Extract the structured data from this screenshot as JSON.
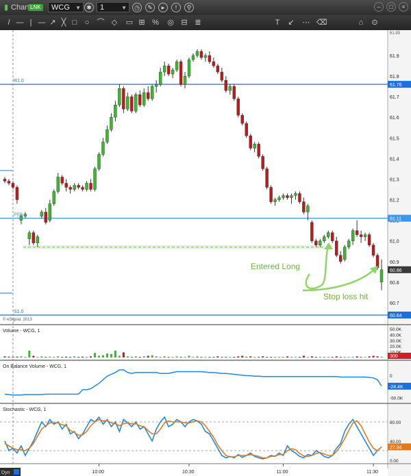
{
  "window": {
    "title": "Chart",
    "badge": "LNK",
    "symbol": "WCG",
    "interval": "1",
    "symbol_menu_icon": "chevron-down-icon",
    "interval_menu_icon": "chevron-down-icon",
    "toolbar_icons": [
      "gear-icon",
      "clock-icon",
      "edit-icon",
      "play-icon",
      "alert-icon",
      "link-icon"
    ],
    "window_buttons": [
      "minimize-icon",
      "maximize-icon",
      "close-icon"
    ]
  },
  "drawing_toolbar": {
    "tools": [
      "/",
      "—",
      "|",
      "—",
      "↗",
      "╳",
      "□",
      "○",
      "⌒",
      "◇",
      "▭",
      "⊞",
      "%",
      "◎",
      "⊟",
      "≣",
      "T",
      "↙",
      "⋯",
      "⌫",
      "⌂",
      "⊙"
    ]
  },
  "price_panel": {
    "copyright": "© eSignal, 2013",
    "levels": [
      {
        "label": "R1.0",
        "value": 61.76,
        "color": "#1e6fd9"
      },
      {
        "label": "P(0)",
        "value": 61.11,
        "color": "#3f95e6"
      },
      {
        "label": "S1.0",
        "value": 60.64,
        "color": "#1e6fd9"
      }
    ],
    "entry_line": {
      "value": 60.97,
      "color": "#8fd66a"
    },
    "axis_ticks": [
      "61.9",
      "61.8",
      "61.7",
      "61.6",
      "61.5",
      "61.4",
      "61.3",
      "61.2",
      "61.1",
      "61.0",
      "60.9",
      "60.8",
      "60.7"
    ],
    "axis_top": "61.93",
    "price_tags": [
      {
        "text": "61.76",
        "value": 61.76,
        "bg": "#1e6fd9"
      },
      {
        "text": "61.11",
        "value": 61.11,
        "bg": "#3f95e6"
      },
      {
        "text": "60.86",
        "value": 60.86,
        "bg": "#3a3a3a"
      },
      {
        "text": "60.64",
        "value": 60.64,
        "bg": "#1e6fd9"
      }
    ],
    "annotations": [
      {
        "text": "Entered Long",
        "color": "#6ab53a"
      },
      {
        "text": "Stop loss hit",
        "color": "#6ab53a"
      }
    ]
  },
  "volume_panel": {
    "title": "Volume - WCG, 1",
    "axis_ticks": [
      "50.0K",
      "40.0K",
      "30.0K",
      "20.0K",
      "10.0K"
    ],
    "last_tag": "300",
    "last_tag_bg": "#cc2222"
  },
  "obv_panel": {
    "title": "On Balance Volume - WCG, 1",
    "axis_ticks": [
      "0",
      "-50.0K"
    ],
    "last_tag": "-24.4K",
    "last_tag_bg": "#1e6fd9",
    "line_color": "#1e88e5"
  },
  "stoch_panel": {
    "title": "Stochastic - WCG, 1",
    "axis_ticks": [
      "80.00",
      "40.00",
      "0.00"
    ],
    "last_tag": "27.94",
    "last_tag_bg": "#e07a1f",
    "k_color": "#1e88e5",
    "d_color": "#e07a1f"
  },
  "time_axis": {
    "labels": [
      "10:00",
      "10:30",
      "11:00",
      "11:30"
    ],
    "left_label": "Dyn",
    "left_icon": "fit-icon"
  },
  "chart_data": {
    "type": "candlestick",
    "symbol": "WCG",
    "interval": "1",
    "price_ylim": [
      60.6,
      61.93
    ],
    "x_ticks": [
      "10:00",
      "10:30",
      "11:00",
      "11:30"
    ],
    "candles": [
      {
        "o": 61.3,
        "h": 61.31,
        "l": 61.28,
        "c": 61.29
      },
      {
        "o": 61.29,
        "h": 61.3,
        "l": 61.27,
        "c": 61.28
      },
      {
        "o": 61.28,
        "h": 61.29,
        "l": 61.25,
        "c": 61.26
      },
      {
        "o": 61.26,
        "h": 61.27,
        "l": 61.18,
        "c": 61.2
      },
      {
        "o": 61.1,
        "h": 61.13,
        "l": 61.08,
        "c": 61.12
      },
      {
        "o": 61.12,
        "h": 61.14,
        "l": 61.11,
        "c": 61.13
      },
      {
        "o": 61.01,
        "h": 61.05,
        "l": 60.98,
        "c": 61.04
      },
      {
        "o": 61.04,
        "h": 61.05,
        "l": 60.98,
        "c": 60.99
      },
      {
        "o": 60.99,
        "h": 61.03,
        "l": 60.97,
        "c": 61.02
      },
      {
        "o": 61.12,
        "h": 61.15,
        "l": 61.11,
        "c": 61.14
      },
      {
        "o": 61.14,
        "h": 61.16,
        "l": 61.08,
        "c": 61.09
      },
      {
        "o": 61.1,
        "h": 61.2,
        "l": 61.09,
        "c": 61.18
      },
      {
        "o": 61.18,
        "h": 61.25,
        "l": 61.17,
        "c": 61.24
      },
      {
        "o": 61.24,
        "h": 61.33,
        "l": 61.23,
        "c": 61.31
      },
      {
        "o": 61.31,
        "h": 61.32,
        "l": 61.27,
        "c": 61.28
      },
      {
        "o": 61.28,
        "h": 61.3,
        "l": 61.24,
        "c": 61.26
      },
      {
        "o": 61.26,
        "h": 61.27,
        "l": 61.23,
        "c": 61.25
      },
      {
        "o": 61.25,
        "h": 61.28,
        "l": 61.24,
        "c": 61.27
      },
      {
        "o": 61.27,
        "h": 61.28,
        "l": 61.25,
        "c": 61.26
      },
      {
        "o": 61.26,
        "h": 61.27,
        "l": 61.24,
        "c": 61.25
      },
      {
        "o": 61.25,
        "h": 61.29,
        "l": 61.24,
        "c": 61.28
      },
      {
        "o": 61.28,
        "h": 61.3,
        "l": 61.24,
        "c": 61.25
      },
      {
        "o": 61.25,
        "h": 61.36,
        "l": 61.24,
        "c": 61.35
      },
      {
        "o": 61.35,
        "h": 61.43,
        "l": 61.34,
        "c": 61.42
      },
      {
        "o": 61.42,
        "h": 61.5,
        "l": 61.41,
        "c": 61.48
      },
      {
        "o": 61.48,
        "h": 61.56,
        "l": 61.47,
        "c": 61.54
      },
      {
        "o": 61.54,
        "h": 61.62,
        "l": 61.53,
        "c": 61.6
      },
      {
        "o": 61.6,
        "h": 61.68,
        "l": 61.58,
        "c": 61.66
      },
      {
        "o": 61.66,
        "h": 61.76,
        "l": 61.65,
        "c": 61.74
      },
      {
        "o": 61.74,
        "h": 61.75,
        "l": 61.62,
        "c": 61.64
      },
      {
        "o": 61.64,
        "h": 61.72,
        "l": 61.63,
        "c": 61.7
      },
      {
        "o": 61.7,
        "h": 61.71,
        "l": 61.62,
        "c": 61.63
      },
      {
        "o": 61.63,
        "h": 61.72,
        "l": 61.62,
        "c": 61.71
      },
      {
        "o": 61.71,
        "h": 61.73,
        "l": 61.65,
        "c": 61.66
      },
      {
        "o": 61.66,
        "h": 61.74,
        "l": 61.65,
        "c": 61.72
      },
      {
        "o": 61.72,
        "h": 61.75,
        "l": 61.68,
        "c": 61.69
      },
      {
        "o": 61.69,
        "h": 61.76,
        "l": 61.68,
        "c": 61.75
      },
      {
        "o": 61.75,
        "h": 61.78,
        "l": 61.72,
        "c": 61.76
      },
      {
        "o": 61.76,
        "h": 61.84,
        "l": 61.75,
        "c": 61.82
      },
      {
        "o": 61.82,
        "h": 61.87,
        "l": 61.8,
        "c": 61.85
      },
      {
        "o": 61.85,
        "h": 61.86,
        "l": 61.8,
        "c": 61.81
      },
      {
        "o": 61.81,
        "h": 61.84,
        "l": 61.79,
        "c": 61.83
      },
      {
        "o": 61.83,
        "h": 61.88,
        "l": 61.82,
        "c": 61.87
      },
      {
        "o": 61.87,
        "h": 61.88,
        "l": 61.75,
        "c": 61.76
      },
      {
        "o": 61.76,
        "h": 61.82,
        "l": 61.74,
        "c": 61.8
      },
      {
        "o": 61.8,
        "h": 61.89,
        "l": 61.79,
        "c": 61.88
      },
      {
        "o": 61.88,
        "h": 61.91,
        "l": 61.87,
        "c": 61.9
      },
      {
        "o": 61.9,
        "h": 61.93,
        "l": 61.89,
        "c": 61.92
      },
      {
        "o": 61.92,
        "h": 61.93,
        "l": 61.88,
        "c": 61.89
      },
      {
        "o": 61.89,
        "h": 61.91,
        "l": 61.87,
        "c": 61.9
      },
      {
        "o": 61.9,
        "h": 61.92,
        "l": 61.86,
        "c": 61.87
      },
      {
        "o": 61.87,
        "h": 61.89,
        "l": 61.84,
        "c": 61.85
      },
      {
        "o": 61.85,
        "h": 61.86,
        "l": 61.81,
        "c": 61.82
      },
      {
        "o": 61.82,
        "h": 61.84,
        "l": 61.77,
        "c": 61.78
      },
      {
        "o": 61.78,
        "h": 61.8,
        "l": 61.72,
        "c": 61.73
      },
      {
        "o": 61.73,
        "h": 61.76,
        "l": 61.71,
        "c": 61.75
      },
      {
        "o": 61.75,
        "h": 61.76,
        "l": 61.68,
        "c": 61.69
      },
      {
        "o": 61.69,
        "h": 61.7,
        "l": 61.6,
        "c": 61.61
      },
      {
        "o": 61.61,
        "h": 61.62,
        "l": 61.56,
        "c": 61.57
      },
      {
        "o": 61.57,
        "h": 61.58,
        "l": 61.5,
        "c": 61.51
      },
      {
        "o": 61.51,
        "h": 61.52,
        "l": 61.44,
        "c": 61.45
      },
      {
        "o": 61.45,
        "h": 61.48,
        "l": 61.43,
        "c": 61.47
      },
      {
        "o": 61.47,
        "h": 61.48,
        "l": 61.4,
        "c": 61.41
      },
      {
        "o": 61.41,
        "h": 61.42,
        "l": 61.34,
        "c": 61.35
      },
      {
        "o": 61.35,
        "h": 61.36,
        "l": 61.25,
        "c": 61.26
      },
      {
        "o": 61.26,
        "h": 61.27,
        "l": 61.18,
        "c": 61.19
      },
      {
        "o": 61.19,
        "h": 61.21,
        "l": 61.17,
        "c": 61.2
      },
      {
        "o": 61.2,
        "h": 61.22,
        "l": 61.19,
        "c": 61.21
      },
      {
        "o": 61.21,
        "h": 61.23,
        "l": 61.2,
        "c": 61.22
      },
      {
        "o": 61.22,
        "h": 61.23,
        "l": 61.2,
        "c": 61.21
      },
      {
        "o": 61.21,
        "h": 61.23,
        "l": 61.18,
        "c": 61.22
      },
      {
        "o": 61.22,
        "h": 61.24,
        "l": 61.2,
        "c": 61.23
      },
      {
        "o": 61.23,
        "h": 61.24,
        "l": 61.18,
        "c": 61.19
      },
      {
        "o": 61.19,
        "h": 61.21,
        "l": 61.13,
        "c": 61.14
      },
      {
        "o": 61.14,
        "h": 61.18,
        "l": 61.1,
        "c": 61.17
      },
      {
        "o": 61.09,
        "h": 61.1,
        "l": 60.99,
        "c": 61.0
      },
      {
        "o": 61.0,
        "h": 61.01,
        "l": 60.97,
        "c": 60.98
      },
      {
        "o": 60.98,
        "h": 61.01,
        "l": 60.97,
        "c": 61.0
      },
      {
        "o": 61.0,
        "h": 61.03,
        "l": 60.99,
        "c": 61.02
      },
      {
        "o": 61.02,
        "h": 61.05,
        "l": 61.01,
        "c": 61.04
      },
      {
        "o": 61.04,
        "h": 61.05,
        "l": 60.99,
        "c": 61.0
      },
      {
        "o": 61.0,
        "h": 61.02,
        "l": 60.92,
        "c": 60.93
      },
      {
        "o": 60.93,
        "h": 60.95,
        "l": 60.89,
        "c": 60.9
      },
      {
        "o": 60.91,
        "h": 60.98,
        "l": 60.9,
        "c": 60.97
      },
      {
        "o": 60.97,
        "h": 61.01,
        "l": 60.96,
        "c": 61.0
      },
      {
        "o": 61.0,
        "h": 61.06,
        "l": 60.98,
        "c": 61.05
      },
      {
        "o": 61.05,
        "h": 61.1,
        "l": 61.02,
        "c": 61.03
      },
      {
        "o": 61.03,
        "h": 61.05,
        "l": 60.99,
        "c": 61.02
      },
      {
        "o": 61.02,
        "h": 61.04,
        "l": 61.0,
        "c": 61.03
      },
      {
        "o": 61.03,
        "h": 61.04,
        "l": 60.97,
        "c": 60.98
      },
      {
        "o": 60.98,
        "h": 60.99,
        "l": 60.92,
        "c": 60.93
      },
      {
        "o": 60.93,
        "h": 60.94,
        "l": 60.86,
        "c": 60.87
      },
      {
        "o": 60.8,
        "h": 60.91,
        "l": 60.76,
        "c": 60.86
      }
    ],
    "volume_k": [
      2,
      1.5,
      1,
      1.5,
      2,
      1,
      12,
      3,
      1,
      2,
      1,
      1.5,
      1,
      2,
      1,
      1.5,
      1,
      2,
      1,
      1.5,
      1,
      2,
      8,
      3,
      4,
      7,
      6,
      12,
      3,
      9,
      2,
      1,
      2,
      1,
      2,
      3,
      4,
      2,
      1,
      2,
      1,
      1,
      2,
      1,
      1,
      3,
      1,
      2,
      1,
      1,
      1,
      1,
      2,
      1,
      1,
      1,
      1,
      2,
      3,
      1,
      2,
      1,
      1,
      2,
      1,
      1,
      1,
      1,
      1,
      2,
      1,
      1,
      1,
      3,
      1,
      2,
      1,
      1,
      1,
      1,
      1,
      2,
      1,
      1,
      1,
      1,
      2,
      1,
      1,
      2,
      3,
      2,
      1
    ],
    "obv_k": [
      -42,
      -43,
      -44,
      -44,
      -44,
      -43,
      -43,
      -43,
      -43,
      -43,
      -42,
      -42,
      -42,
      -42,
      -42,
      -42,
      -42,
      -42,
      -42,
      -32,
      -32,
      -30,
      -24,
      -18,
      -10,
      -2,
      2,
      6,
      12,
      12,
      6,
      4,
      6,
      6,
      6,
      6,
      6,
      6,
      4,
      4,
      4,
      6,
      8,
      8,
      8,
      8,
      8,
      8,
      8,
      7,
      6,
      6,
      5,
      4,
      4,
      3,
      2,
      1,
      0,
      -1,
      -1,
      -2,
      -2,
      -3,
      -3,
      -3,
      -3,
      -3,
      -3,
      -3,
      -3,
      -3,
      -3,
      -3,
      -3,
      -3,
      -3,
      -3,
      -3,
      -3,
      -3,
      -3,
      -4,
      -4,
      -4,
      -4,
      -4,
      -4,
      -4,
      -5,
      -6,
      -10,
      -24
    ],
    "stoch_k": [
      40,
      20,
      25,
      15,
      30,
      10,
      25,
      40,
      60,
      80,
      70,
      85,
      75,
      80,
      65,
      75,
      55,
      60,
      45,
      55,
      70,
      85,
      80,
      90,
      75,
      85,
      70,
      80,
      60,
      85,
      78,
      70,
      80,
      65,
      70,
      55,
      40,
      65,
      80,
      90,
      70,
      75,
      85,
      80,
      70,
      80,
      85,
      82,
      75,
      60,
      55,
      40,
      25,
      10,
      5,
      8,
      5,
      12,
      6,
      10,
      15,
      8,
      5,
      3,
      5,
      10,
      8,
      15,
      10,
      30,
      20,
      15,
      8,
      5,
      12,
      10,
      20,
      15,
      8,
      5,
      10,
      25,
      35,
      60,
      75,
      85,
      70,
      55,
      40,
      25,
      10,
      20,
      28
    ],
    "stoch_d": [
      35,
      30,
      25,
      22,
      22,
      20,
      25,
      35,
      50,
      65,
      72,
      78,
      78,
      78,
      74,
      72,
      62,
      58,
      52,
      53,
      60,
      72,
      80,
      85,
      82,
      83,
      78,
      76,
      72,
      76,
      78,
      76,
      76,
      72,
      70,
      62,
      55,
      55,
      65,
      78,
      82,
      80,
      80,
      80,
      78,
      78,
      80,
      82,
      80,
      72,
      60,
      48,
      32,
      20,
      10,
      7,
      7,
      10,
      10,
      10,
      12,
      10,
      8,
      5,
      5,
      8,
      9,
      12,
      12,
      20,
      24,
      22,
      14,
      9,
      8,
      10,
      14,
      16,
      13,
      10,
      10,
      18,
      30,
      45,
      62,
      78,
      82,
      72,
      55,
      38,
      25,
      20,
      27.94
    ]
  }
}
